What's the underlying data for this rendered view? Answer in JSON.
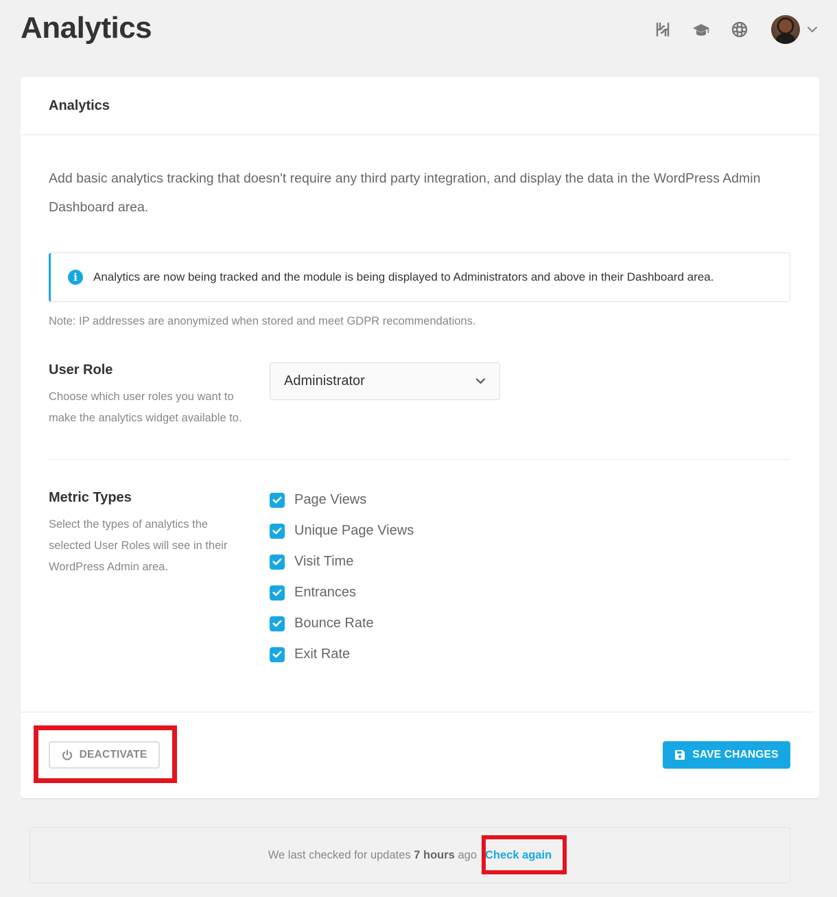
{
  "page": {
    "title": "Analytics"
  },
  "topbar": {
    "icons": [
      "hub-icon",
      "academy-icon",
      "support-icon"
    ],
    "avatar": "user-avatar",
    "menu_icon": "chevron-down-icon"
  },
  "card": {
    "title": "Analytics",
    "intro": "Add basic analytics tracking that doesn't require any third party integration, and display the data in the WordPress Admin Dashboard area.",
    "notice": "Analytics are now being tracked and the module is being displayed to Administrators and above in their Dashboard area.",
    "note": "Note: IP addresses are anonymized when stored and meet GDPR recommendations."
  },
  "user_role": {
    "title": "User Role",
    "description": "Choose which user roles you want to make the analytics widget available to.",
    "selected": "Administrator"
  },
  "metric_types": {
    "title": "Metric Types",
    "description": "Select the types of analytics the selected User Roles will see in their WordPress Admin area.",
    "items": [
      {
        "label": "Page Views",
        "checked": true
      },
      {
        "label": "Unique Page Views",
        "checked": true
      },
      {
        "label": "Visit Time",
        "checked": true
      },
      {
        "label": "Entrances",
        "checked": true
      },
      {
        "label": "Bounce Rate",
        "checked": true
      },
      {
        "label": "Exit Rate",
        "checked": true
      }
    ]
  },
  "footer": {
    "deactivate_label": "DEACTIVATE",
    "save_label": "SAVE CHANGES"
  },
  "updates": {
    "prefix": "We last checked for updates",
    "time": "7 hours",
    "suffix": "ago",
    "check_again": "Check again"
  },
  "colors": {
    "accent": "#17a8e3",
    "highlight": "#e3141e",
    "background": "#f1f1f1"
  }
}
